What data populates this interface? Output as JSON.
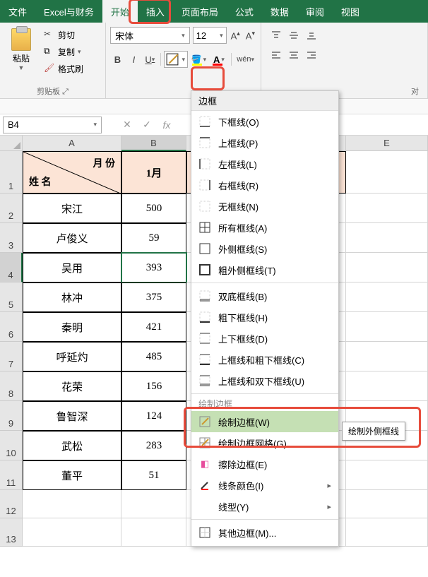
{
  "tabs": {
    "file": "文件",
    "custom": "Excel与财务",
    "home": "开始",
    "insert": "插入",
    "pagelayout": "页面布局",
    "formulas": "公式",
    "data": "数据",
    "review": "审阅",
    "view": "视图"
  },
  "ribbon": {
    "clipboard": {
      "paste": "粘贴",
      "cut": "剪切",
      "copy": "复制",
      "format_painter": "格式刷",
      "group_label": "剪贴板"
    },
    "font": {
      "name": "宋体",
      "size": "12",
      "wen_label": "wén",
      "align_right_label": "对"
    },
    "border_menu": {
      "header": "边框",
      "items": [
        "下框线(O)",
        "上框线(P)",
        "左框线(L)",
        "右框线(R)",
        "无框线(N)",
        "所有框线(A)",
        "外侧框线(S)",
        "粗外侧框线(T)",
        "双底框线(B)",
        "粗下框线(H)",
        "上下框线(D)",
        "上框线和粗下框线(C)",
        "上框线和双下框线(U)"
      ],
      "section_draw": "绘制边框",
      "draw_border": "绘制边框(W)",
      "draw_grid": "绘制边框网格(G)",
      "erase": "擦除边框(E)",
      "line_color": "线条颜色(I)",
      "line_style": "线型(Y)",
      "more": "其他边框(M)...",
      "tooltip": "绘制外侧框线"
    }
  },
  "name_box": "B4",
  "grid": {
    "col_headers": [
      "A",
      "B",
      "E"
    ],
    "header_cell": {
      "month": "月 份",
      "name": "姓 名",
      "col1": "1月"
    },
    "rows": [
      {
        "name": "宋江",
        "v": "500"
      },
      {
        "name": "卢俊义",
        "v": "59"
      },
      {
        "name": "吴用",
        "v": "393"
      },
      {
        "name": "林冲",
        "v": "375"
      },
      {
        "name": "秦明",
        "v": "421"
      },
      {
        "name": "呼延灼",
        "v": "485"
      },
      {
        "name": "花荣",
        "v": "156"
      },
      {
        "name": "鲁智深",
        "v": "124"
      },
      {
        "name": "武松",
        "v": "283"
      },
      {
        "name": "董平",
        "v": "51"
      }
    ]
  }
}
